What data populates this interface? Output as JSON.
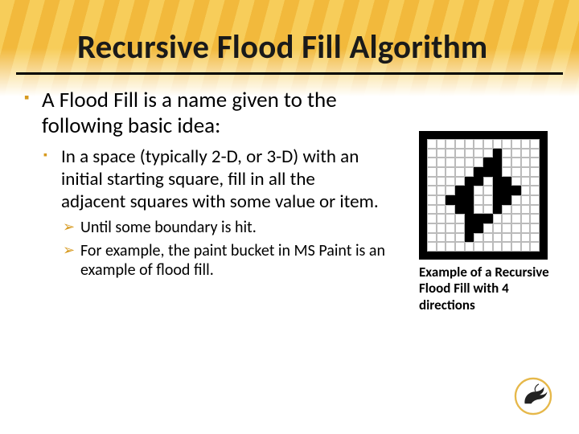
{
  "title": "Recursive Flood Fill Algorithm",
  "bullets": {
    "l1": "A Flood Fill is a name given to the following basic idea:",
    "l2": "In a space (typically 2-D, or 3-D) with an initial starting square, fill in all the adjacent squares with some value or item.",
    "l3a": "Until some boundary is hit.",
    "l3b": "For example, the paint bucket in MS Paint is an example of flood fill."
  },
  "caption": "Example of a Recursive Flood Fill with 4 directions",
  "grid": {
    "size": 12,
    "black_cells": [
      [
        1,
        7
      ],
      [
        2,
        6
      ],
      [
        2,
        7
      ],
      [
        3,
        5
      ],
      [
        3,
        6
      ],
      [
        3,
        7
      ],
      [
        4,
        4
      ],
      [
        4,
        5
      ],
      [
        4,
        7
      ],
      [
        4,
        8
      ],
      [
        5,
        3
      ],
      [
        5,
        4
      ],
      [
        5,
        7
      ],
      [
        5,
        8
      ],
      [
        5,
        9
      ],
      [
        6,
        2
      ],
      [
        6,
        3
      ],
      [
        6,
        4
      ],
      [
        6,
        7
      ],
      [
        6,
        8
      ],
      [
        7,
        3
      ],
      [
        7,
        4
      ],
      [
        7,
        7
      ],
      [
        8,
        4
      ],
      [
        8,
        5
      ],
      [
        8,
        6
      ],
      [
        9,
        4
      ],
      [
        9,
        5
      ],
      [
        10,
        4
      ]
    ]
  }
}
